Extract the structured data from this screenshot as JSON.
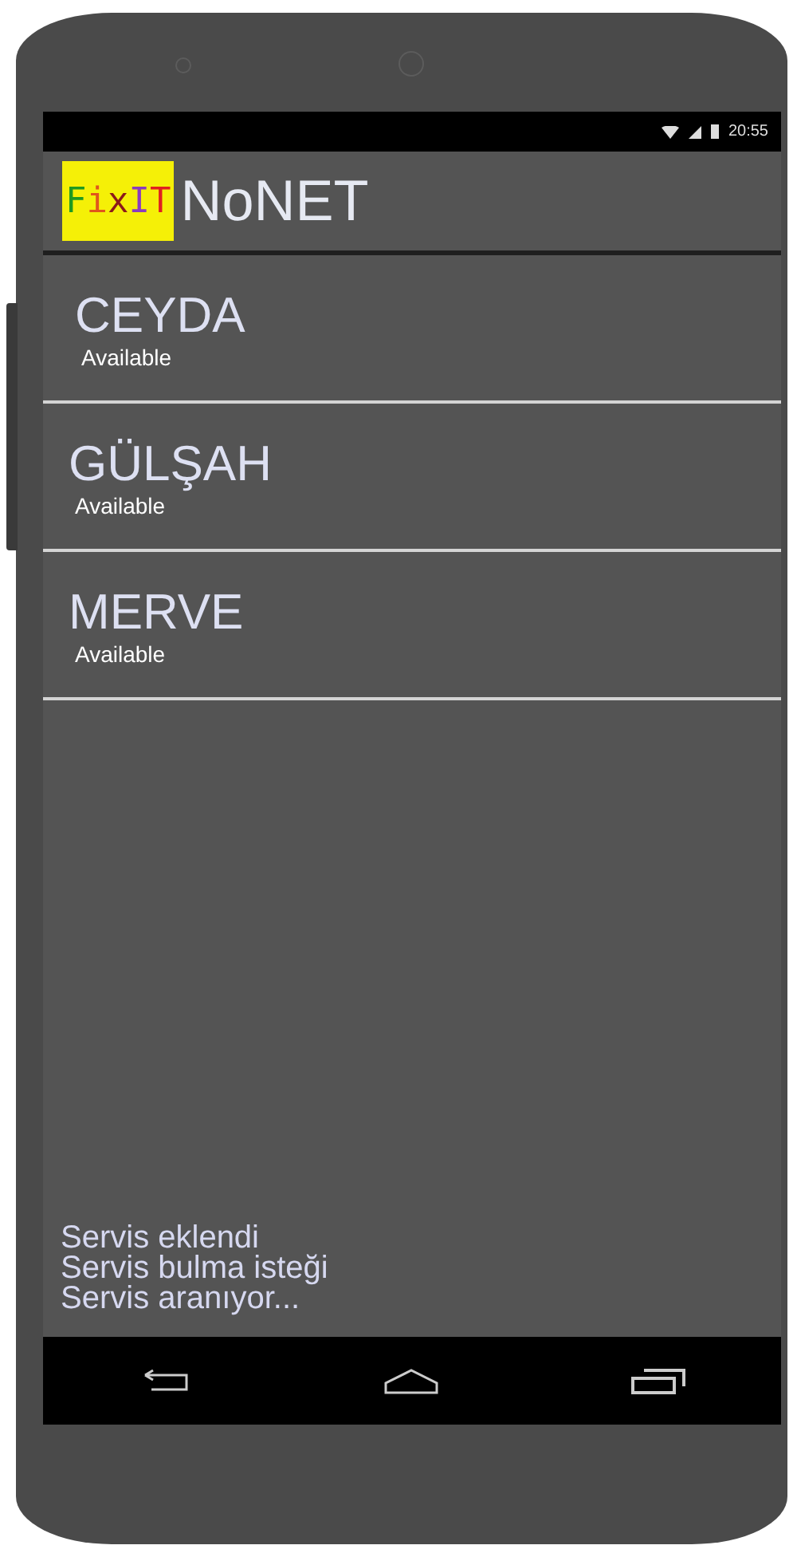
{
  "status_bar": {
    "time": "20:55"
  },
  "app_bar": {
    "logo": {
      "letters": [
        {
          "text": "F",
          "color": "#1f9a1f"
        },
        {
          "text": "i",
          "color": "#e0561c"
        },
        {
          "text": "x",
          "color": "#8b1a1a"
        },
        {
          "text": "I",
          "color": "#8a3bbf"
        },
        {
          "text": "T",
          "color": "#e02020"
        }
      ]
    },
    "title": "NoNET"
  },
  "devices": [
    {
      "name": "CEYDA",
      "status": "Available"
    },
    {
      "name": "GÜLŞAH",
      "status": "Available"
    },
    {
      "name": "MERVE",
      "status": "Available"
    }
  ],
  "log": [
    "Servis eklendi",
    "Servis bulma isteği",
    "Servis aranıyor..."
  ]
}
